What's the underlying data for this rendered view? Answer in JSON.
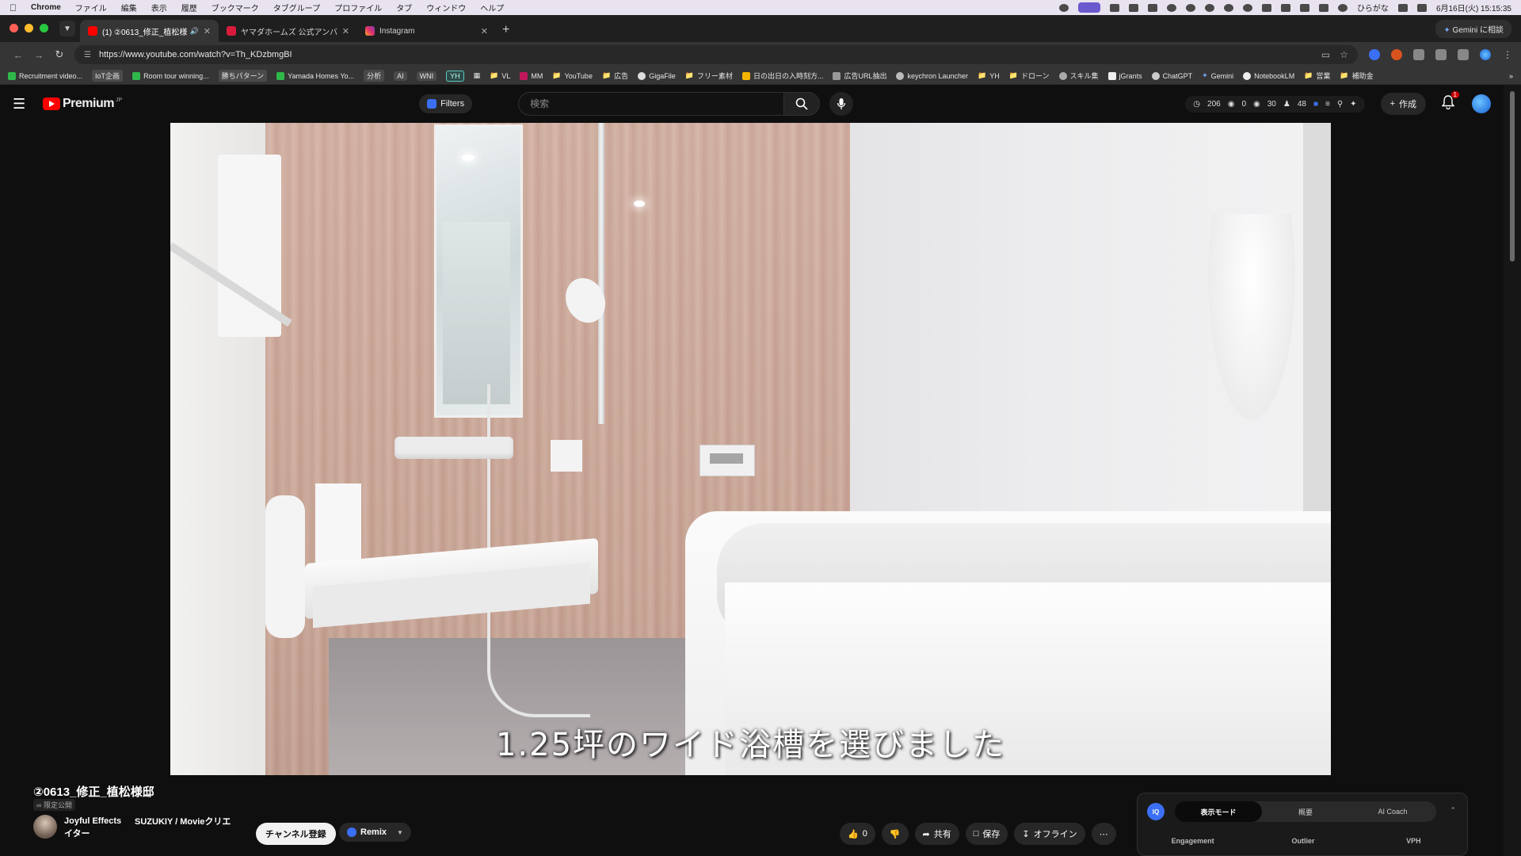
{
  "menubar": {
    "app_name": "Chrome",
    "items": [
      "ファイル",
      "編集",
      "表示",
      "履歴",
      "ブックマーク",
      "タブグループ",
      "プロファイル",
      "タブ",
      "ウィンドウ",
      "ヘルプ"
    ],
    "ime": "ひらがな",
    "clock": "6月16日(火) 15:15:35"
  },
  "tabs": [
    {
      "title": "(1) ②0613_修正_植松様邸",
      "favicon_color": "#ff0000"
    },
    {
      "title": "ヤマダホームズ 公式アンバサダー",
      "favicon_color": "#d81b3c"
    },
    {
      "title": "Instagram",
      "favicon_color": "#e1306c"
    }
  ],
  "gemini_button": "Gemini に相談",
  "address": {
    "url": "https://www.youtube.com/watch?v=Th_KDzbmgBI"
  },
  "bookmarks": [
    "Recruitment video...",
    "IoT企画",
    "Room tour winning...",
    "勝ちパターン",
    "Yamada Homes Yo...",
    "分析",
    "AI",
    "WNI",
    "YH",
    "VL",
    "MM",
    "YouTube",
    "広告",
    "GigaFile",
    "フリー素材",
    "日の出日の入時刻方...",
    "広告URL抽出",
    "keychron Launcher",
    "YH",
    "ドローン",
    "スキル集",
    "jGrants",
    "ChatGPT",
    "Gemini",
    "NotebookLM",
    "営業",
    "補助金"
  ],
  "yt": {
    "logo_text": "Premium",
    "logo_region": "JP",
    "filters_label": "Filters",
    "search_placeholder": "検索",
    "stats": {
      "views": "206",
      "v2": "0",
      "v3": "30",
      "v4": "48"
    },
    "create_label": "作成",
    "notif_count": "1"
  },
  "video": {
    "subtitle": "1.25坪のワイド浴槽を選びました"
  },
  "meta": {
    "title": "②0613_修正_植松様邸",
    "visibility": "限定公開",
    "channel": "Joyful Effects",
    "channel2_line1": "SUZUKIY / Movieクリエ",
    "channel2_line2": "イター",
    "subscribe_label": "チャンネル登録",
    "remix_label": "Remix",
    "likes": "0",
    "share_label": "共有",
    "save_label": "保存",
    "offline_label": "オフライン"
  },
  "vidiq": {
    "logo": "IQ",
    "tabs": [
      "表示モード",
      "概要",
      "AI Coach"
    ],
    "metrics": [
      "Engagement",
      "Outlier",
      "VPH"
    ]
  }
}
